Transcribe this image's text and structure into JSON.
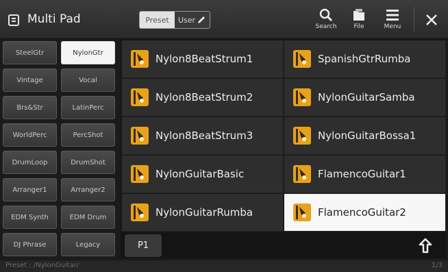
{
  "header": {
    "title": "Multi Pad",
    "app_icon": "multipad-icon",
    "preset_label": "Preset",
    "user_label": "User",
    "search_label": "Search",
    "file_label": "File",
    "menu_label": "Menu"
  },
  "categories": [
    {
      "label": "SteelGtr",
      "selected": false
    },
    {
      "label": "NylonGtr",
      "selected": true
    },
    {
      "label": "Vintage",
      "selected": false
    },
    {
      "label": "Vocal",
      "selected": false
    },
    {
      "label": "Brs&Str",
      "selected": false
    },
    {
      "label": "LatinPerc",
      "selected": false
    },
    {
      "label": "WorldPerc",
      "selected": false
    },
    {
      "label": "PercShot",
      "selected": false
    },
    {
      "label": "DrumLoop",
      "selected": false
    },
    {
      "label": "DrumShot",
      "selected": false
    },
    {
      "label": "Arranger1",
      "selected": false
    },
    {
      "label": "Arranger2",
      "selected": false
    },
    {
      "label": "EDM Synth",
      "selected": false
    },
    {
      "label": "EDM Drum",
      "selected": false
    },
    {
      "label": "DJ Phrase",
      "selected": false
    },
    {
      "label": "Legacy",
      "selected": false
    }
  ],
  "pads": [
    {
      "name": "Nylon8BeatStrum1",
      "selected": false
    },
    {
      "name": "SpanishGtrRumba",
      "selected": false
    },
    {
      "name": "Nylon8BeatStrum2",
      "selected": false
    },
    {
      "name": "NylonGuitarSamba",
      "selected": false
    },
    {
      "name": "Nylon8BeatStrum3",
      "selected": false
    },
    {
      "name": "NylonGuitarBossa1",
      "selected": false
    },
    {
      "name": "NylonGuitarBasic",
      "selected": false
    },
    {
      "name": "FlamencoGuitar1",
      "selected": false
    },
    {
      "name": "NylonGuitarRumba",
      "selected": false
    },
    {
      "name": "FlamencoGuitar2",
      "selected": true
    }
  ],
  "pager": {
    "current_page": "P1"
  },
  "status": {
    "path": "Preset : /NylonGuitar/",
    "page_count": "1/3"
  },
  "colors": {
    "pad_icon": "#e8a21a",
    "selected_bg": "#f7f7f7",
    "header_bg": "#333333"
  }
}
